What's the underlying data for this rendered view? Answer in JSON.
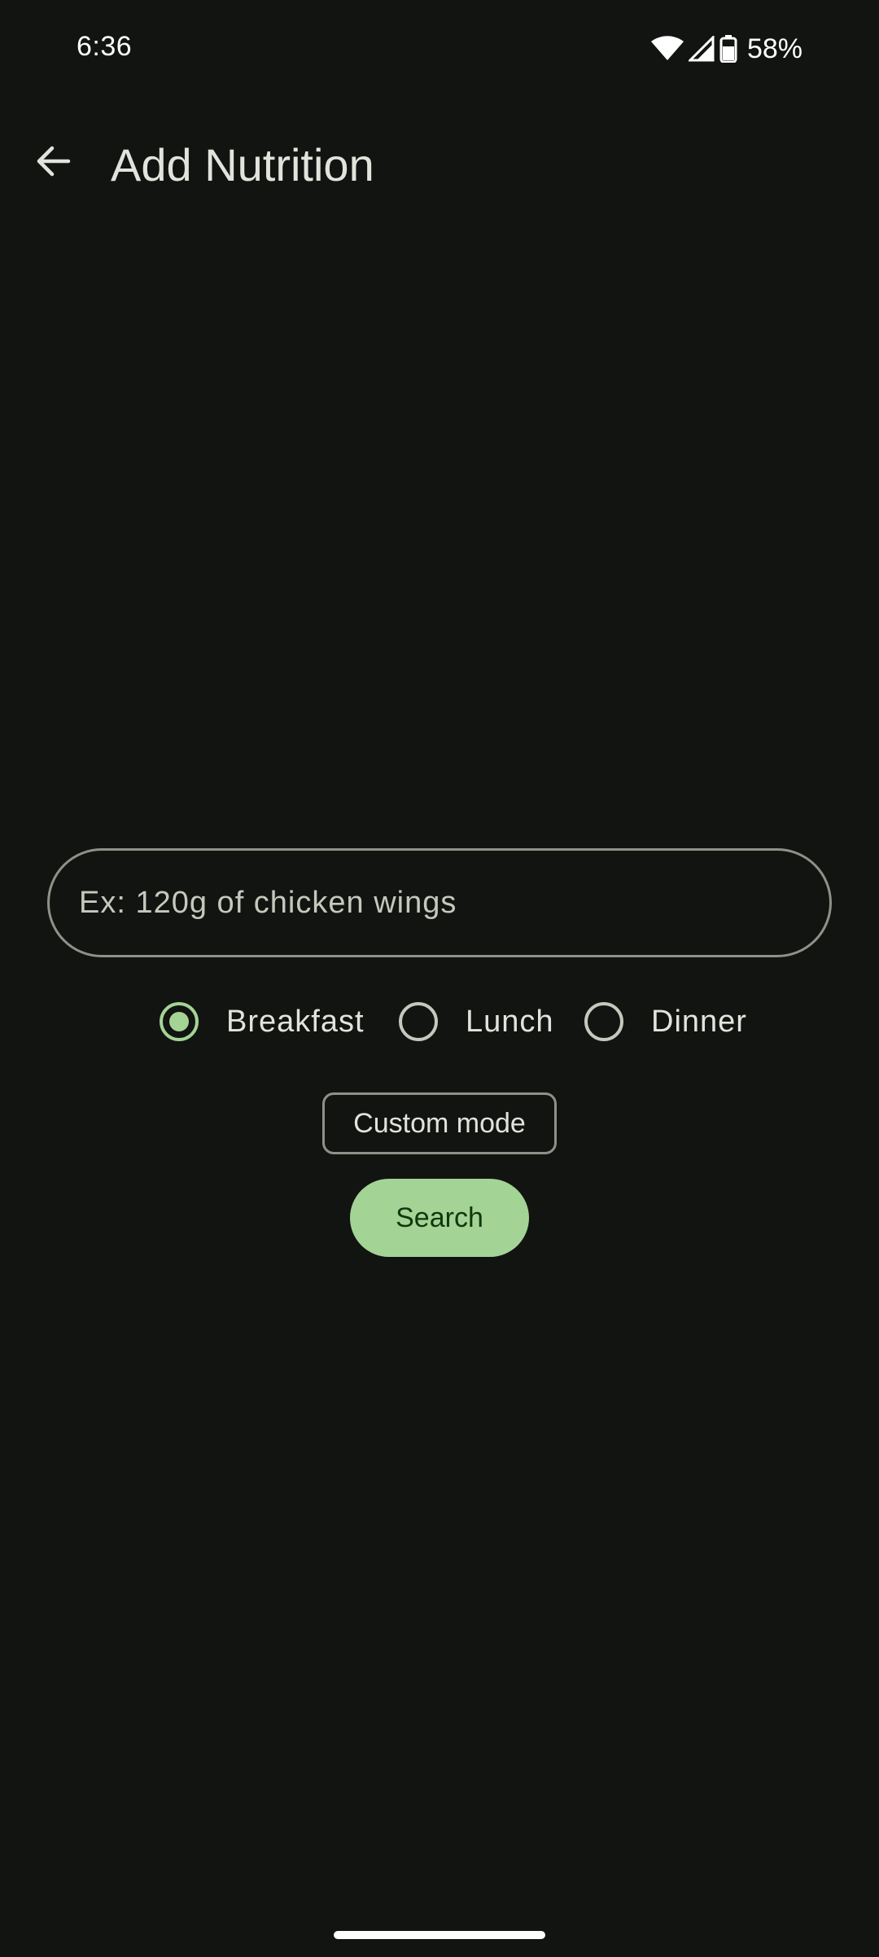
{
  "status_bar": {
    "time": "6:36",
    "battery": "58%",
    "icons": [
      "wifi-icon",
      "cellular-signal-icon",
      "battery-icon"
    ]
  },
  "app_bar": {
    "back_icon": "arrow-back-icon",
    "title": "Add Nutrition"
  },
  "search": {
    "placeholder": "Ex: 120g of chicken wings",
    "value": ""
  },
  "meal_options": [
    {
      "label": "Breakfast",
      "selected": true
    },
    {
      "label": "Lunch",
      "selected": false
    },
    {
      "label": "Dinner",
      "selected": false
    }
  ],
  "buttons": {
    "custom_mode": "Custom mode",
    "search": "Search"
  },
  "colors": {
    "background": "#121411",
    "accent": "#a4d396",
    "outline": "#8f9189",
    "text": "#e2e3dc"
  }
}
